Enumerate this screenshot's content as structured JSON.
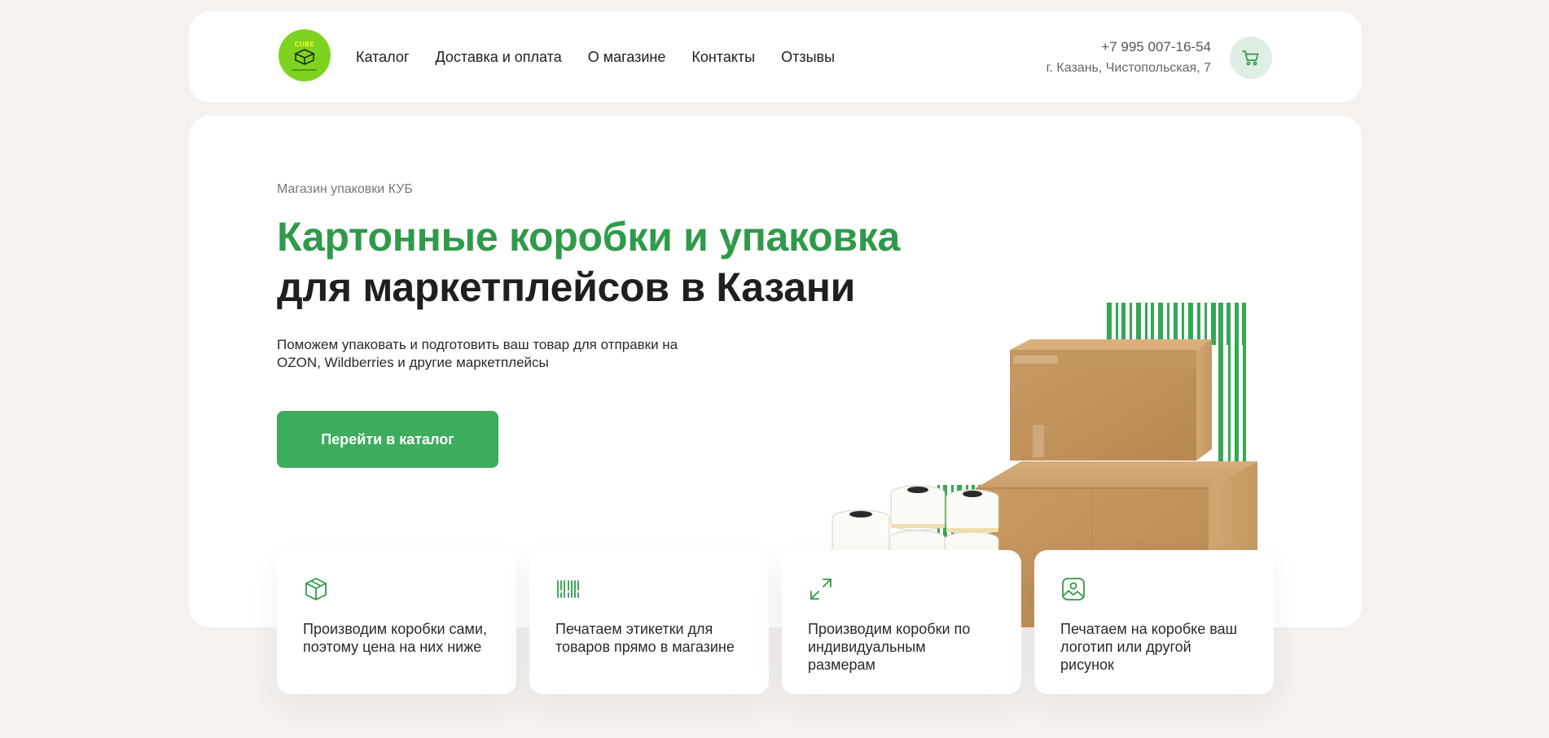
{
  "header": {
    "logo_word": "CUBE",
    "nav": [
      "Каталог",
      "Доставка и оплата",
      "О магазине",
      "Контакты",
      "Отзывы"
    ],
    "phone": "+7 995 007-16-54",
    "address": "г. Казань, Чистопольская, 7",
    "cart_icon": "cart-icon"
  },
  "hero": {
    "eyebrow": "Магазин упаковки КУБ",
    "title_line1": "Картонные коробки и упаковка",
    "title_line2": "для маркетплейсов в Казани",
    "subtitle": "Поможем упаковать и подготовить ваш товар для отправки на OZON, Wildberries и другие маркетплейсы",
    "cta_label": "Перейти в каталог"
  },
  "features": [
    {
      "icon": "box-icon",
      "text": "Производим коробки сами, поэтому цена на них ниже"
    },
    {
      "icon": "barcode-icon",
      "text": "Печатаем этикетки для товаров прямо в магазине"
    },
    {
      "icon": "resize-icon",
      "text": "Производим коробки по индивидуальным размерам"
    },
    {
      "icon": "image-icon",
      "text": "Печатаем на коробке ваш логотип или другой рисунок"
    }
  ],
  "colors": {
    "accent_green": "#3dac5c",
    "title_green": "#2f9a49",
    "logo_green": "#7ed321",
    "page_bg": "#f4f1ef"
  }
}
